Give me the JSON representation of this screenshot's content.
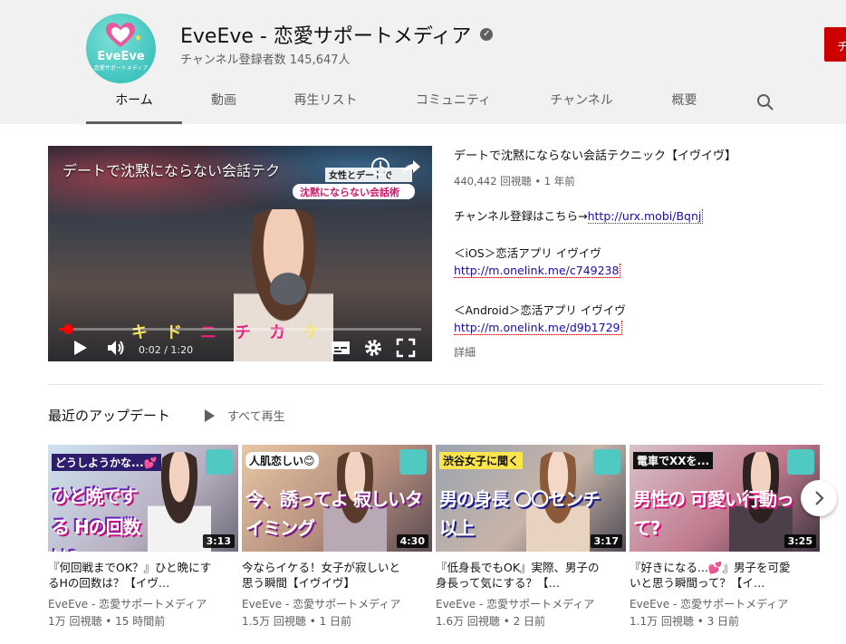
{
  "channel": {
    "name": "EveEve - 恋愛サポートメディア",
    "subscribers": "チャンネル登録者数 145,647人",
    "subscribe_label": "チ",
    "avatar_brand": "EveEve",
    "avatar_sub": "恋愛サポートメディア"
  },
  "tabs": [
    "ホーム",
    "動画",
    "再生リスト",
    "コミュニティ",
    "チャンネル",
    "概要"
  ],
  "player": {
    "title": "デートで沈黙にならない会話テク",
    "overlay_top": "女性とデートで",
    "overlay_main": "沈黙にならない会話術",
    "caption": [
      "キ",
      "ド",
      "ニ",
      "チ",
      "カ",
      "ケ"
    ],
    "time": "0:02 / 1:20",
    "progress": 0.025,
    "accent": "#ff0000"
  },
  "featured": {
    "title": "デートで沈黙にならない会話テクニック【イヴイヴ】",
    "meta": "440,442 回視聴 • 1 年前",
    "desc": [
      {
        "text": "チャンネル登録はこちら→",
        "link": "http://urx.mobi/Bqnj"
      },
      {
        "text": "＜iOS＞恋活アプリ イヴイヴ",
        "link": ""
      },
      {
        "text": "",
        "link": "http://m.onelink.me/c749238"
      },
      {
        "text": "＜Android＞恋活アプリ イヴイヴ",
        "link": ""
      },
      {
        "text": "",
        "link": "http://m.onelink.me/d9b1729"
      }
    ],
    "more": "詳細"
  },
  "shelf": {
    "title": "最近のアップデート",
    "play_all": "すべて再生",
    "videos": [
      {
        "thumb_top": "どうしようかな...💕",
        "thumb_main": "ひと晩でする Hの回数は?",
        "duration": "3:13",
        "title": "『何回戦までOK？』ひと晩にするHの回数は？【イヴ…",
        "channel": "EveEve - 恋愛サポートメディア",
        "meta": "1万 回視聴 • 15 時間前"
      },
      {
        "thumb_top": "人肌恋しい😊",
        "thumb_main": "今、誘ってよ 寂しいタイミング",
        "duration": "4:30",
        "title": "今ならイケる！女子が寂しいと思う瞬間【イヴイヴ】",
        "channel": "EveEve - 恋愛サポートメディア",
        "meta": "1.5万 回視聴 • 1 日前"
      },
      {
        "thumb_top": "渋谷女子に聞く",
        "thumb_main": "男の身長 〇〇センチ以上",
        "duration": "3:17",
        "title": "『低身長でもOK』実際、男子の身長って気にする？【…",
        "channel": "EveEve - 恋愛サポートメディア",
        "meta": "1.6万 回視聴 • 2 日前"
      },
      {
        "thumb_top": "電車でXXを...",
        "thumb_main": "男性の 可愛い行動って?",
        "duration": "3:25",
        "title": "『好きになる...💕』男子を可愛いと思う瞬間って？【イ…",
        "channel": "EveEve - 恋愛サポートメディア",
        "meta": "1.1万 回視聴 • 3 日前"
      }
    ]
  }
}
